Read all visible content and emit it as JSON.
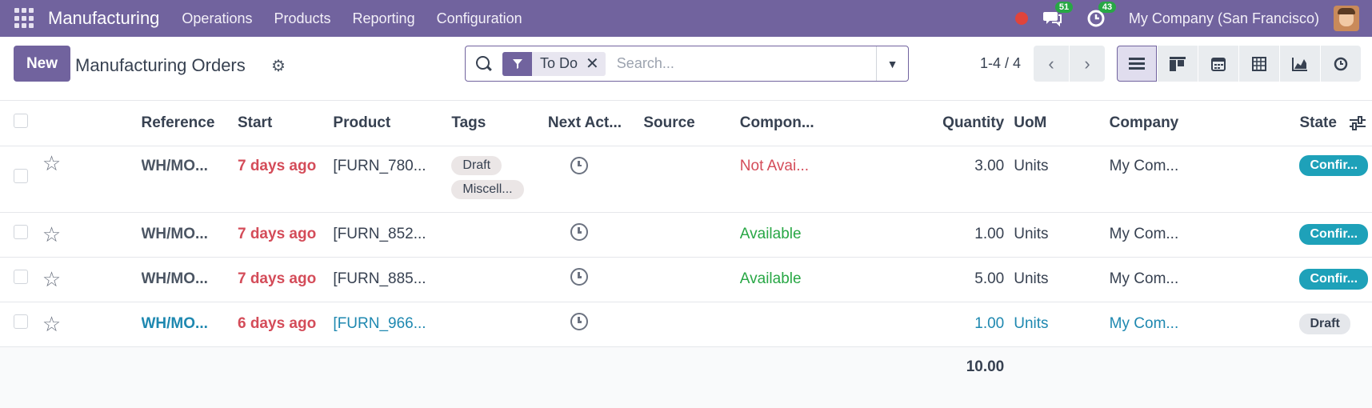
{
  "navbar": {
    "app_name": "Manufacturing",
    "menu": [
      "Operations",
      "Products",
      "Reporting",
      "Configuration"
    ],
    "messages_count": "51",
    "activities_count": "43",
    "company": "My Company (San Francisco)"
  },
  "control": {
    "new_label": "New",
    "title": "Manufacturing Orders",
    "facet_label": "To Do",
    "search_placeholder": "Search...",
    "pager": "1-4 / 4"
  },
  "table": {
    "headers": [
      "Reference",
      "Start",
      "Product",
      "Tags",
      "Next Act...",
      "Source",
      "Compon...",
      "Quantity",
      "UoM",
      "Company",
      "State"
    ],
    "rows": [
      {
        "reference": "WH/MO...",
        "start": "7 days ago",
        "product": "[FURN_780...",
        "tags": [
          "Draft",
          "Miscell..."
        ],
        "components": "Not Avai...",
        "quantity": "3.00",
        "uom": "Units",
        "company": "My Com...",
        "state": "Confir..."
      },
      {
        "reference": "WH/MO...",
        "start": "7 days ago",
        "product": "[FURN_852...",
        "tags": [],
        "components": "Available",
        "quantity": "1.00",
        "uom": "Units",
        "company": "My Com...",
        "state": "Confir..."
      },
      {
        "reference": "WH/MO...",
        "start": "7 days ago",
        "product": "[FURN_885...",
        "tags": [],
        "components": "Available",
        "quantity": "5.00",
        "uom": "Units",
        "company": "My Com...",
        "state": "Confir..."
      },
      {
        "reference": "WH/MO...",
        "start": "6 days ago",
        "product": "[FURN_966...",
        "tags": [],
        "components": "",
        "quantity": "1.00",
        "uom": "Units",
        "company": "My Com...",
        "state": "Draft"
      }
    ],
    "total_quantity": "10.00"
  },
  "colors": {
    "brand": "#71639e",
    "danger": "#d44c59",
    "success": "#28a745",
    "info": "#1ea1b9"
  }
}
